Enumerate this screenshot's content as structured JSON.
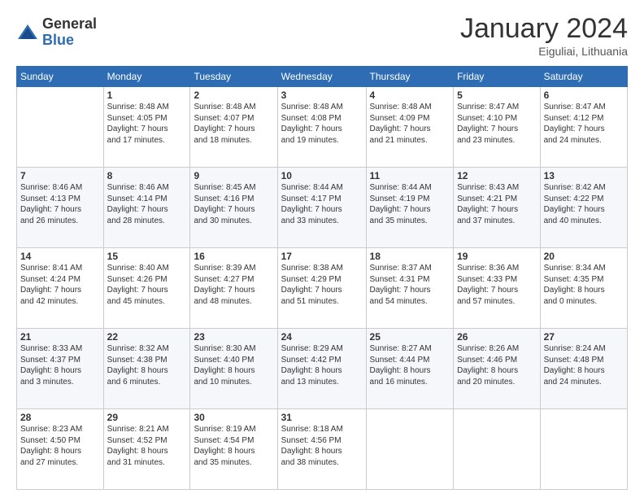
{
  "logo": {
    "general": "General",
    "blue": "Blue"
  },
  "title": "January 2024",
  "subtitle": "Eiguliai, Lithuania",
  "days_of_week": [
    "Sunday",
    "Monday",
    "Tuesday",
    "Wednesday",
    "Thursday",
    "Friday",
    "Saturday"
  ],
  "weeks": [
    [
      {
        "day": "",
        "info": ""
      },
      {
        "day": "1",
        "info": "Sunrise: 8:48 AM\nSunset: 4:05 PM\nDaylight: 7 hours\nand 17 minutes."
      },
      {
        "day": "2",
        "info": "Sunrise: 8:48 AM\nSunset: 4:07 PM\nDaylight: 7 hours\nand 18 minutes."
      },
      {
        "day": "3",
        "info": "Sunrise: 8:48 AM\nSunset: 4:08 PM\nDaylight: 7 hours\nand 19 minutes."
      },
      {
        "day": "4",
        "info": "Sunrise: 8:48 AM\nSunset: 4:09 PM\nDaylight: 7 hours\nand 21 minutes."
      },
      {
        "day": "5",
        "info": "Sunrise: 8:47 AM\nSunset: 4:10 PM\nDaylight: 7 hours\nand 23 minutes."
      },
      {
        "day": "6",
        "info": "Sunrise: 8:47 AM\nSunset: 4:12 PM\nDaylight: 7 hours\nand 24 minutes."
      }
    ],
    [
      {
        "day": "7",
        "info": "Sunrise: 8:46 AM\nSunset: 4:13 PM\nDaylight: 7 hours\nand 26 minutes."
      },
      {
        "day": "8",
        "info": "Sunrise: 8:46 AM\nSunset: 4:14 PM\nDaylight: 7 hours\nand 28 minutes."
      },
      {
        "day": "9",
        "info": "Sunrise: 8:45 AM\nSunset: 4:16 PM\nDaylight: 7 hours\nand 30 minutes."
      },
      {
        "day": "10",
        "info": "Sunrise: 8:44 AM\nSunset: 4:17 PM\nDaylight: 7 hours\nand 33 minutes."
      },
      {
        "day": "11",
        "info": "Sunrise: 8:44 AM\nSunset: 4:19 PM\nDaylight: 7 hours\nand 35 minutes."
      },
      {
        "day": "12",
        "info": "Sunrise: 8:43 AM\nSunset: 4:21 PM\nDaylight: 7 hours\nand 37 minutes."
      },
      {
        "day": "13",
        "info": "Sunrise: 8:42 AM\nSunset: 4:22 PM\nDaylight: 7 hours\nand 40 minutes."
      }
    ],
    [
      {
        "day": "14",
        "info": "Sunrise: 8:41 AM\nSunset: 4:24 PM\nDaylight: 7 hours\nand 42 minutes."
      },
      {
        "day": "15",
        "info": "Sunrise: 8:40 AM\nSunset: 4:26 PM\nDaylight: 7 hours\nand 45 minutes."
      },
      {
        "day": "16",
        "info": "Sunrise: 8:39 AM\nSunset: 4:27 PM\nDaylight: 7 hours\nand 48 minutes."
      },
      {
        "day": "17",
        "info": "Sunrise: 8:38 AM\nSunset: 4:29 PM\nDaylight: 7 hours\nand 51 minutes."
      },
      {
        "day": "18",
        "info": "Sunrise: 8:37 AM\nSunset: 4:31 PM\nDaylight: 7 hours\nand 54 minutes."
      },
      {
        "day": "19",
        "info": "Sunrise: 8:36 AM\nSunset: 4:33 PM\nDaylight: 7 hours\nand 57 minutes."
      },
      {
        "day": "20",
        "info": "Sunrise: 8:34 AM\nSunset: 4:35 PM\nDaylight: 8 hours\nand 0 minutes."
      }
    ],
    [
      {
        "day": "21",
        "info": "Sunrise: 8:33 AM\nSunset: 4:37 PM\nDaylight: 8 hours\nand 3 minutes."
      },
      {
        "day": "22",
        "info": "Sunrise: 8:32 AM\nSunset: 4:38 PM\nDaylight: 8 hours\nand 6 minutes."
      },
      {
        "day": "23",
        "info": "Sunrise: 8:30 AM\nSunset: 4:40 PM\nDaylight: 8 hours\nand 10 minutes."
      },
      {
        "day": "24",
        "info": "Sunrise: 8:29 AM\nSunset: 4:42 PM\nDaylight: 8 hours\nand 13 minutes."
      },
      {
        "day": "25",
        "info": "Sunrise: 8:27 AM\nSunset: 4:44 PM\nDaylight: 8 hours\nand 16 minutes."
      },
      {
        "day": "26",
        "info": "Sunrise: 8:26 AM\nSunset: 4:46 PM\nDaylight: 8 hours\nand 20 minutes."
      },
      {
        "day": "27",
        "info": "Sunrise: 8:24 AM\nSunset: 4:48 PM\nDaylight: 8 hours\nand 24 minutes."
      }
    ],
    [
      {
        "day": "28",
        "info": "Sunrise: 8:23 AM\nSunset: 4:50 PM\nDaylight: 8 hours\nand 27 minutes."
      },
      {
        "day": "29",
        "info": "Sunrise: 8:21 AM\nSunset: 4:52 PM\nDaylight: 8 hours\nand 31 minutes."
      },
      {
        "day": "30",
        "info": "Sunrise: 8:19 AM\nSunset: 4:54 PM\nDaylight: 8 hours\nand 35 minutes."
      },
      {
        "day": "31",
        "info": "Sunrise: 8:18 AM\nSunset: 4:56 PM\nDaylight: 8 hours\nand 38 minutes."
      },
      {
        "day": "",
        "info": ""
      },
      {
        "day": "",
        "info": ""
      },
      {
        "day": "",
        "info": ""
      }
    ]
  ]
}
